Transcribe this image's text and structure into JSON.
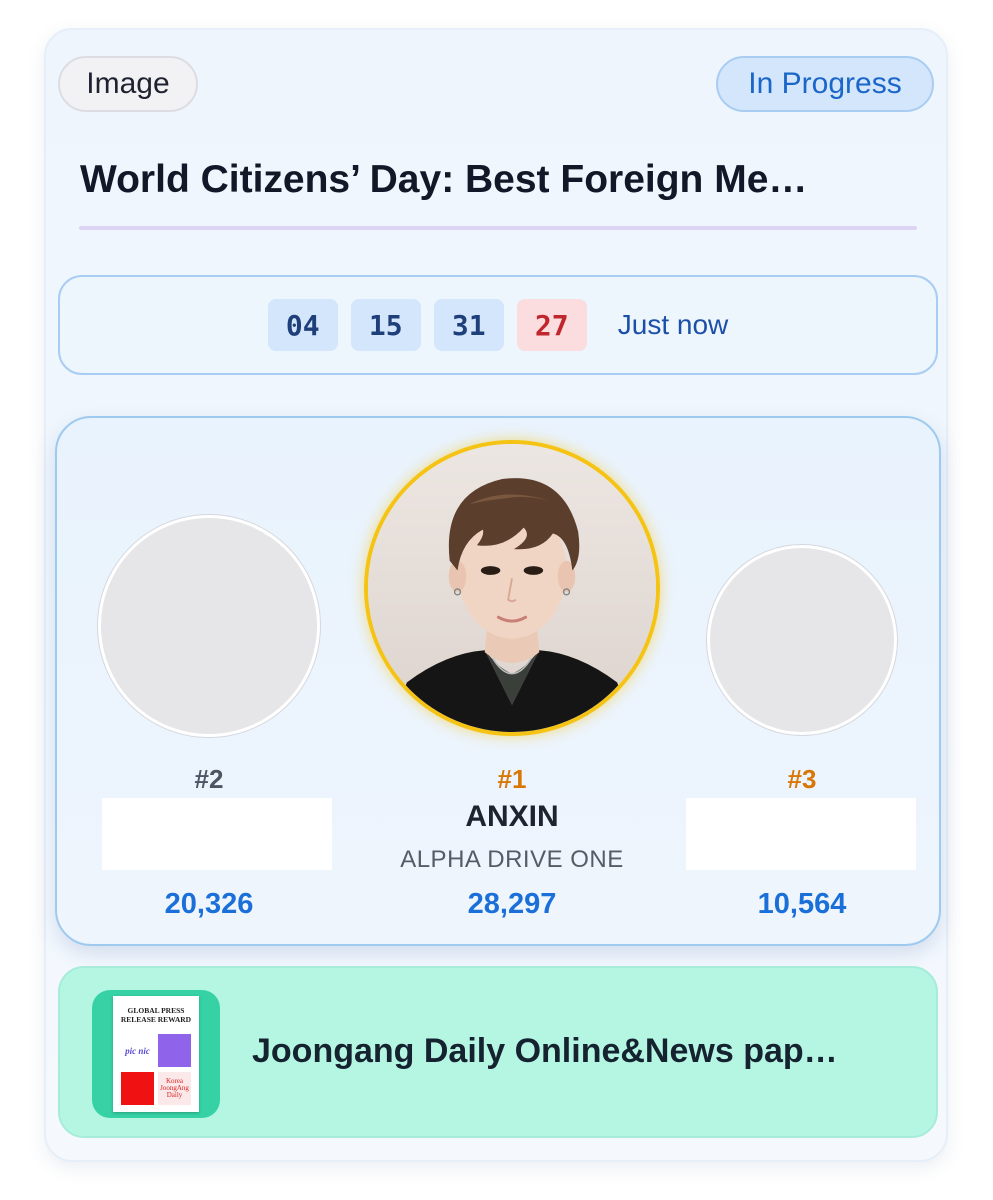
{
  "card": {
    "type_label": "Image",
    "status_label": "In Progress",
    "title": "World Citizens’ Day: Best Foreign Me…"
  },
  "timer": {
    "days": "04",
    "hours": "15",
    "minutes": "31",
    "seconds": "27",
    "updated": "Just now"
  },
  "podium": {
    "first": {
      "rank": "#1",
      "name": "ANXIN",
      "group": "ALPHA DRIVE ONE",
      "votes": "28,297"
    },
    "second": {
      "rank": "#2",
      "votes": "20,326"
    },
    "third": {
      "rank": "#3",
      "votes": "10,564"
    }
  },
  "reward": {
    "title": "Joongang Daily Online&News pap…",
    "thumb_heading": "GLOBAL PRESS RELEASE REWARD",
    "thumb_logo": "pic nic",
    "thumb_brand": "Korea JoongAng Daily"
  },
  "colors": {
    "accent_blue": "#1b6fd8",
    "gold": "#f5c314",
    "rank_orange": "#d97706",
    "reward_bg": "#b4f6e2",
    "seconds_red": "#c0262d"
  }
}
